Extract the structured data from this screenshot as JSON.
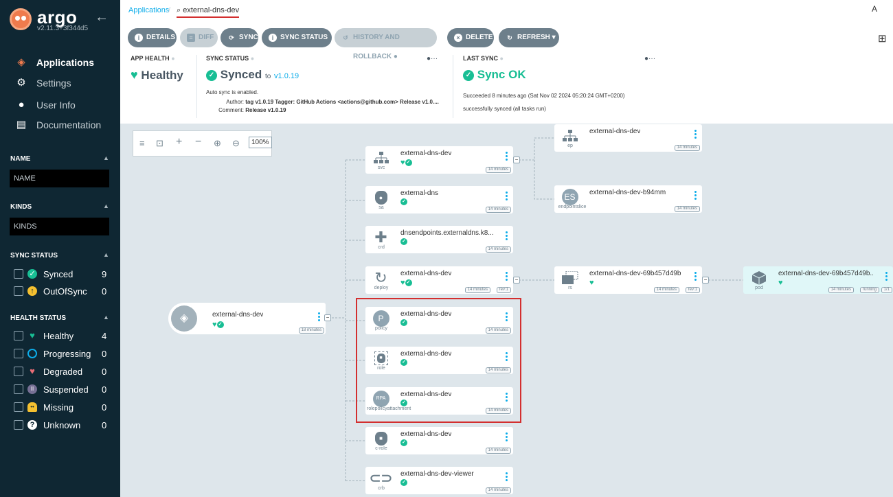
{
  "sidebar": {
    "brand": "argo",
    "version": "v2.11.3+3f344d5",
    "nav": [
      {
        "label": "Applications"
      },
      {
        "label": "Settings"
      },
      {
        "label": "User Info"
      },
      {
        "label": "Documentation"
      }
    ],
    "filters": {
      "name_title": "NAME",
      "name_placeholder": "NAME",
      "kinds_title": "KINDS",
      "kinds_placeholder": "KINDS",
      "sync_title": "SYNC STATUS",
      "sync": [
        {
          "label": "Synced",
          "count": "9"
        },
        {
          "label": "OutOfSync",
          "count": "0"
        }
      ],
      "health_title": "HEALTH STATUS",
      "health": [
        {
          "label": "Healthy",
          "count": "4"
        },
        {
          "label": "Progressing",
          "count": "0"
        },
        {
          "label": "Degraded",
          "count": "0"
        },
        {
          "label": "Suspended",
          "count": "0"
        },
        {
          "label": "Missing",
          "count": "0"
        },
        {
          "label": "Unknown",
          "count": "0"
        }
      ]
    }
  },
  "breadcrumb": {
    "root": "Applications",
    "current": "external-dns-dev"
  },
  "toolbar": {
    "details": "DETAILS",
    "diff": "DIFF",
    "sync": "SYNC",
    "sync_status": "SYNC STATUS",
    "history": "HISTORY AND ROLLBACK",
    "delete": "DELETE",
    "refresh": "REFRESH"
  },
  "status": {
    "app_health_title": "APP HEALTH",
    "app_health": "Healthy",
    "sync_title": "SYNC STATUS",
    "sync_value": "Synced",
    "sync_to": "to",
    "sync_rev": "v1.0.19",
    "auto_sync": "Auto sync is enabled.",
    "author_label": "Author:",
    "author": "tag v1.0.19 Tagger: GitHub Actions <actions@github.com> Release v1.0....",
    "comment_label": "Comment:",
    "comment": "Release v1.0.19",
    "last_sync_title": "LAST SYNC",
    "last_sync": "Sync OK",
    "succeeded": "Succeeded 8 minutes ago (Sat Nov 02 2024 05:20:24 GMT+0200)",
    "sync_msg": "successfully synced (all tasks run)"
  },
  "zoom": "100%",
  "nodes": {
    "app": {
      "name": "external-dns-dev",
      "age": "18 minutes"
    },
    "svc": {
      "name": "external-dns-dev",
      "kind": "svc",
      "age": "14 minutes"
    },
    "sa": {
      "name": "external-dns",
      "kind": "sa",
      "age": "14 minutes"
    },
    "crd": {
      "name": "dnsendpoints.externaldns.k8...",
      "kind": "crd",
      "age": "14 minutes"
    },
    "deploy": {
      "name": "external-dns-dev",
      "kind": "deploy",
      "age": "14 minutes",
      "rev": "rev:1"
    },
    "policy": {
      "name": "external-dns-dev",
      "kind": "policy",
      "age": "14 minutes",
      "glyph": "P"
    },
    "role": {
      "name": "external-dns-dev",
      "kind": "role",
      "age": "14 minutes"
    },
    "rpa": {
      "name": "external-dns-dev",
      "kind": "rolepolicyattachment",
      "age": "14 minutes",
      "glyph": "RPA"
    },
    "crole": {
      "name": "external-dns-dev",
      "kind": "c-role",
      "age": "14 minutes"
    },
    "crb": {
      "name": "external-dns-dev-viewer",
      "kind": "crb",
      "age": "14 minutes"
    },
    "ep": {
      "name": "external-dns-dev",
      "kind": "ep",
      "age": "14 minutes"
    },
    "es": {
      "name": "external-dns-dev-b94mm",
      "kind": "endpointslice",
      "age": "14 minutes",
      "glyph": "ES"
    },
    "rs": {
      "name": "external-dns-dev-69b457d49b",
      "kind": "rs",
      "age": "14 minutes",
      "rev": "rev:1"
    },
    "pod": {
      "name": "external-dns-dev-69b457d49b...",
      "kind": "pod",
      "age": "14 minutes",
      "state": "running",
      "ready": "1/1"
    }
  }
}
